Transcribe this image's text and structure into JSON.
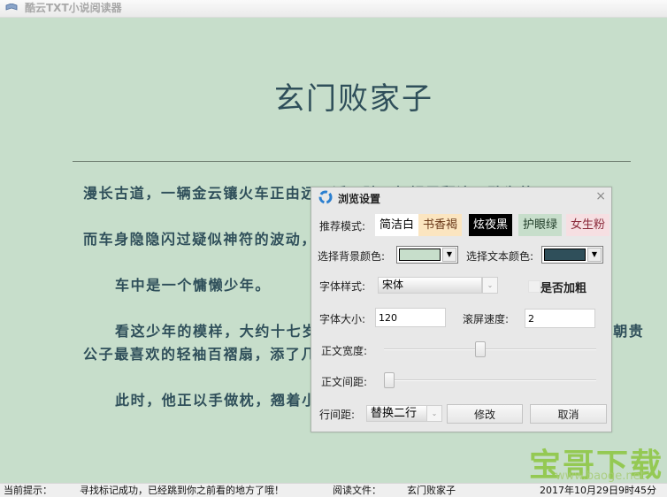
{
  "window": {
    "title": "酷云TXT小说阅读器",
    "icon": "book-icon"
  },
  "reader": {
    "book_title": "玄门败家子",
    "paragraphs": [
      {
        "text": "漫长古道，一辆金云镶火车正由远至近飞驰，如银雪翻滚，殊为壮观。",
        "indent": false
      },
      {
        "text": "而车身隐隐闪过疑似神符的波动，一切的一切，无不在彰显车中人物的身份。",
        "indent": false
      },
      {
        "text": "车中是一个慵懒少年。",
        "indent": true
      },
      {
        "text": "看这少年的模样，大约十七岁，风度翩翩的气质，一身白衣轻装，几分皇朝贵公子最喜欢的轻袖百褶扇，添了几分贵气。",
        "indent": true
      },
      {
        "text": "此时，他正以手做枕，翘着小腿卧在金云镶火车里，身下是柔顺的兽皮",
        "indent": true
      }
    ]
  },
  "watermark": {
    "text": "宝哥下载",
    "url": "www.baoge.net"
  },
  "statusbar": {
    "hint_label": "当前提示：",
    "hint_value": "寻找标记成功，已经跳到你之前看的地方了哦！",
    "file_label": "阅读文件：",
    "file_value": "玄门败家子",
    "datetime": "2017年10月29日9时45分"
  },
  "dialog": {
    "title": "浏览设置",
    "close_label": "×",
    "mode_label": "推荐模式:",
    "modes": [
      {
        "label": "简洁白",
        "bg": "#ffffff",
        "fg": "#000000"
      },
      {
        "label": "书香褐",
        "bg": "#fbe5c0",
        "fg": "#6b3a1a"
      },
      {
        "label": "炫夜黑",
        "bg": "#000000",
        "fg": "#ffffff"
      },
      {
        "label": "护眼绿",
        "bg": "#c7decb",
        "fg": "#1d3a26"
      },
      {
        "label": "女生粉",
        "bg": "#f6dfe2",
        "fg": "#8a2a3a"
      }
    ],
    "bg_color_label": "选择背景颜色:",
    "bg_color_value": "#c7decb",
    "text_color_label": "选择文本颜色:",
    "text_color_value": "#2f4f5a",
    "font_style_label": "字体样式:",
    "font_style_value": "宋体",
    "bold_label": "是否加粗",
    "bold_checked": false,
    "font_size_label": "字体大小:",
    "font_size_value": "120",
    "scroll_speed_label": "滚屏速度:",
    "scroll_speed_value": "2",
    "text_width_label": "正文宽度:",
    "text_width_fraction": 0.45,
    "text_spacing_label": "正文间距:",
    "text_spacing_fraction": 0.0,
    "line_spacing_label": "行间距:",
    "line_spacing_value": "替换二行",
    "modify_label": "修改",
    "cancel_label": "取消"
  }
}
